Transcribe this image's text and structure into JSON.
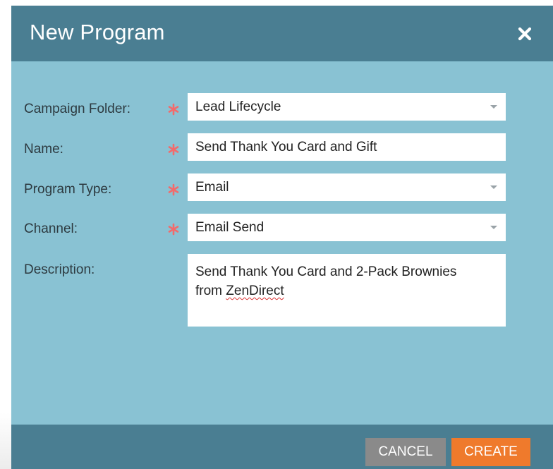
{
  "dialog": {
    "title": "New Program",
    "close_icon": "close-icon"
  },
  "form": {
    "campaign_folder": {
      "label": "Campaign Folder:",
      "value": "Lead Lifecycle",
      "required": true
    },
    "name": {
      "label": "Name:",
      "value": "Send Thank You Card and Gift",
      "required": true
    },
    "program_type": {
      "label": "Program Type:",
      "value": "Email",
      "required": true
    },
    "channel": {
      "label": "Channel:",
      "value": "Email Send",
      "required": true
    },
    "description": {
      "label": "Description:",
      "line1": "Send Thank You Card and 2-Pack Brownies",
      "line2_prefix": "from ",
      "line2_misspelled": "ZenDirect"
    }
  },
  "footer": {
    "cancel_label": "CANCEL",
    "create_label": "CREATE"
  },
  "colors": {
    "header": "#4a7e92",
    "body": "#89c2d3",
    "required_star": "#f26b6b",
    "cancel": "#8a8a8a",
    "create": "#ef7a2c"
  }
}
